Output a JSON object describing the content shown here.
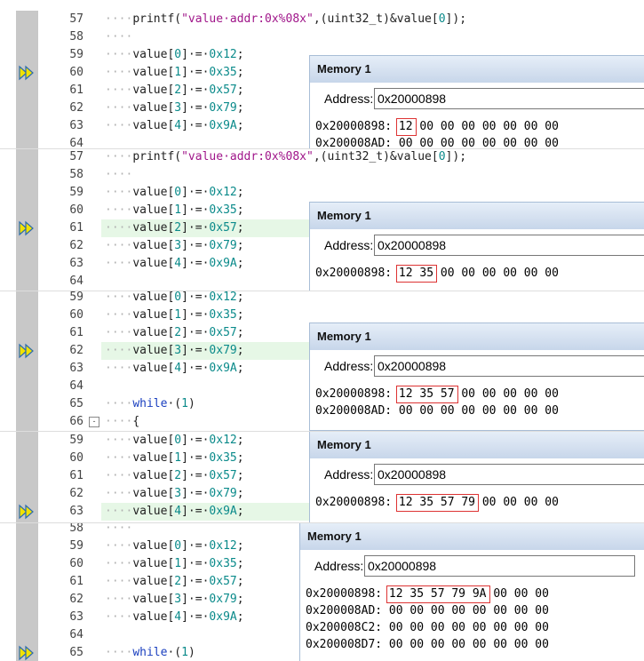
{
  "panels": [
    {
      "lines": [
        {
          "n": "57",
          "code": [
            [
              "dots",
              "····"
            ],
            [
              "t",
              "printf("
            ],
            [
              "str",
              "\"value·addr:0x%08x\""
            ],
            [
              "t",
              ",(uint32_t)&value["
            ],
            [
              "num",
              "0"
            ],
            [
              "t",
              "]);"
            ]
          ]
        },
        {
          "n": "58",
          "code": [
            [
              "dots",
              "····"
            ]
          ]
        },
        {
          "n": "59",
          "code": [
            [
              "dots",
              "····"
            ],
            [
              "t",
              "value["
            ],
            [
              "num",
              "0"
            ],
            [
              "t",
              "]·=·"
            ],
            [
              "num",
              "0x12"
            ],
            [
              "t",
              ";"
            ]
          ]
        },
        {
          "n": "60",
          "code": [
            [
              "dots",
              "····"
            ],
            [
              "t",
              "value["
            ],
            [
              "num",
              "1"
            ],
            [
              "t",
              "]·=·"
            ],
            [
              "num",
              "0x35"
            ],
            [
              "t",
              ";"
            ]
          ]
        },
        {
          "n": "61",
          "code": [
            [
              "dots",
              "····"
            ],
            [
              "t",
              "value["
            ],
            [
              "num",
              "2"
            ],
            [
              "t",
              "]·=·"
            ],
            [
              "num",
              "0x57"
            ],
            [
              "t",
              ";"
            ]
          ]
        },
        {
          "n": "62",
          "code": [
            [
              "dots",
              "····"
            ],
            [
              "t",
              "value["
            ],
            [
              "num",
              "3"
            ],
            [
              "t",
              "]·=·"
            ],
            [
              "num",
              "0x79"
            ],
            [
              "t",
              ";"
            ]
          ]
        },
        {
          "n": "63",
          "code": [
            [
              "dots",
              "····"
            ],
            [
              "t",
              "value["
            ],
            [
              "num",
              "4"
            ],
            [
              "t",
              "]·=·"
            ],
            [
              "num",
              "0x9A"
            ],
            [
              "t",
              ";"
            ]
          ]
        },
        {
          "n": "64",
          "code": []
        }
      ],
      "arrow_line": "60",
      "highlight": "",
      "memory": {
        "title": "Memory 1",
        "address_label": "Address:",
        "address": "0x20000898",
        "rows": [
          "0x20000898: 12 00 00 00 00 00 00 00",
          "0x200008AD: 00 00 00 00 00 00 00 00"
        ],
        "box_bytes": 1
      }
    },
    {
      "lines": [
        {
          "n": "57",
          "code": [
            [
              "dots",
              "····"
            ],
            [
              "t",
              "printf("
            ],
            [
              "str",
              "\"value·addr:0x%08x\""
            ],
            [
              "t",
              ",(uint32_t)&value["
            ],
            [
              "num",
              "0"
            ],
            [
              "t",
              "]);"
            ]
          ]
        },
        {
          "n": "58",
          "code": [
            [
              "dots",
              "····"
            ]
          ]
        },
        {
          "n": "59",
          "code": [
            [
              "dots",
              "····"
            ],
            [
              "t",
              "value["
            ],
            [
              "num",
              "0"
            ],
            [
              "t",
              "]·=·"
            ],
            [
              "num",
              "0x12"
            ],
            [
              "t",
              ";"
            ]
          ]
        },
        {
          "n": "60",
          "code": [
            [
              "dots",
              "····"
            ],
            [
              "t",
              "value["
            ],
            [
              "num",
              "1"
            ],
            [
              "t",
              "]·=·"
            ],
            [
              "num",
              "0x35"
            ],
            [
              "t",
              ";"
            ]
          ]
        },
        {
          "n": "61",
          "code": [
            [
              "dots",
              "····"
            ],
            [
              "t",
              "value["
            ],
            [
              "num",
              "2"
            ],
            [
              "t",
              "]·=·"
            ],
            [
              "num",
              "0x57"
            ],
            [
              "t",
              ";"
            ]
          ]
        },
        {
          "n": "62",
          "code": [
            [
              "dots",
              "····"
            ],
            [
              "t",
              "value["
            ],
            [
              "num",
              "3"
            ],
            [
              "t",
              "]·=·"
            ],
            [
              "num",
              "0x79"
            ],
            [
              "t",
              ";"
            ]
          ]
        },
        {
          "n": "63",
          "code": [
            [
              "dots",
              "····"
            ],
            [
              "t",
              "value["
            ],
            [
              "num",
              "4"
            ],
            [
              "t",
              "]·=·"
            ],
            [
              "num",
              "0x9A"
            ],
            [
              "t",
              ";"
            ]
          ]
        },
        {
          "n": "64",
          "code": []
        }
      ],
      "arrow_line": "61",
      "highlight": "61",
      "memory": {
        "title": "Memory 1",
        "address_label": "Address:",
        "address": "0x20000898",
        "rows": [
          "0x20000898: 12 35 00 00 00 00 00 00"
        ],
        "box_bytes": 2
      }
    },
    {
      "lines": [
        {
          "n": "59",
          "code": [
            [
              "dots",
              "····"
            ],
            [
              "t",
              "value["
            ],
            [
              "num",
              "0"
            ],
            [
              "t",
              "]·=·"
            ],
            [
              "num",
              "0x12"
            ],
            [
              "t",
              ";"
            ]
          ]
        },
        {
          "n": "60",
          "code": [
            [
              "dots",
              "····"
            ],
            [
              "t",
              "value["
            ],
            [
              "num",
              "1"
            ],
            [
              "t",
              "]·=·"
            ],
            [
              "num",
              "0x35"
            ],
            [
              "t",
              ";"
            ]
          ]
        },
        {
          "n": "61",
          "code": [
            [
              "dots",
              "····"
            ],
            [
              "t",
              "value["
            ],
            [
              "num",
              "2"
            ],
            [
              "t",
              "]·=·"
            ],
            [
              "num",
              "0x57"
            ],
            [
              "t",
              ";"
            ]
          ]
        },
        {
          "n": "62",
          "code": [
            [
              "dots",
              "····"
            ],
            [
              "t",
              "value["
            ],
            [
              "num",
              "3"
            ],
            [
              "t",
              "]·=·"
            ],
            [
              "num",
              "0x79"
            ],
            [
              "t",
              ";"
            ]
          ]
        },
        {
          "n": "63",
          "code": [
            [
              "dots",
              "····"
            ],
            [
              "t",
              "value["
            ],
            [
              "num",
              "4"
            ],
            [
              "t",
              "]·=·"
            ],
            [
              "num",
              "0x9A"
            ],
            [
              "t",
              ";"
            ]
          ]
        },
        {
          "n": "64",
          "code": []
        },
        {
          "n": "65",
          "code": [
            [
              "dots",
              "····"
            ],
            [
              "kw",
              "while"
            ],
            [
              "t",
              "·("
            ],
            [
              "num",
              "1"
            ],
            [
              "t",
              ")"
            ]
          ]
        },
        {
          "n": "66",
          "code": [
            [
              "dots",
              "····"
            ],
            [
              "t",
              "{"
            ]
          ],
          "fold": "-"
        }
      ],
      "arrow_line": "62",
      "highlight": "62",
      "memory": {
        "title": "Memory 1",
        "address_label": "Address:",
        "address": "0x20000898",
        "rows": [
          "0x20000898: 12 35 57 00 00 00 00 00",
          "0x200008AD: 00 00 00 00 00 00 00 00"
        ],
        "box_bytes": 3
      }
    },
    {
      "lines": [
        {
          "n": "59",
          "code": [
            [
              "dots",
              "····"
            ],
            [
              "t",
              "value["
            ],
            [
              "num",
              "0"
            ],
            [
              "t",
              "]·=·"
            ],
            [
              "num",
              "0x12"
            ],
            [
              "t",
              ";"
            ]
          ]
        },
        {
          "n": "60",
          "code": [
            [
              "dots",
              "····"
            ],
            [
              "t",
              "value["
            ],
            [
              "num",
              "1"
            ],
            [
              "t",
              "]·=·"
            ],
            [
              "num",
              "0x35"
            ],
            [
              "t",
              ";"
            ]
          ]
        },
        {
          "n": "61",
          "code": [
            [
              "dots",
              "····"
            ],
            [
              "t",
              "value["
            ],
            [
              "num",
              "2"
            ],
            [
              "t",
              "]·=·"
            ],
            [
              "num",
              "0x57"
            ],
            [
              "t",
              ";"
            ]
          ]
        },
        {
          "n": "62",
          "code": [
            [
              "dots",
              "····"
            ],
            [
              "t",
              "value["
            ],
            [
              "num",
              "3"
            ],
            [
              "t",
              "]·=·"
            ],
            [
              "num",
              "0x79"
            ],
            [
              "t",
              ";"
            ]
          ]
        },
        {
          "n": "63",
          "code": [
            [
              "dots",
              "····"
            ],
            [
              "t",
              "value["
            ],
            [
              "num",
              "4"
            ],
            [
              "t",
              "]·=·"
            ],
            [
              "num",
              "0x9A"
            ],
            [
              "t",
              ";"
            ]
          ]
        }
      ],
      "arrow_line": "63",
      "highlight": "63",
      "memory": {
        "title": "Memory 1",
        "address_label": "Address:",
        "address": "0x20000898",
        "rows": [
          "0x20000898: 12 35 57 79 00 00 00 00"
        ],
        "box_bytes": 4
      }
    },
    {
      "lines": [
        {
          "n": "58",
          "code": [
            [
              "dots",
              "····"
            ]
          ]
        },
        {
          "n": "59",
          "code": [
            [
              "dots",
              "····"
            ],
            [
              "t",
              "value["
            ],
            [
              "num",
              "0"
            ],
            [
              "t",
              "]·=·"
            ],
            [
              "num",
              "0x12"
            ],
            [
              "t",
              ";"
            ]
          ]
        },
        {
          "n": "60",
          "code": [
            [
              "dots",
              "····"
            ],
            [
              "t",
              "value["
            ],
            [
              "num",
              "1"
            ],
            [
              "t",
              "]·=·"
            ],
            [
              "num",
              "0x35"
            ],
            [
              "t",
              ";"
            ]
          ]
        },
        {
          "n": "61",
          "code": [
            [
              "dots",
              "····"
            ],
            [
              "t",
              "value["
            ],
            [
              "num",
              "2"
            ],
            [
              "t",
              "]·=·"
            ],
            [
              "num",
              "0x57"
            ],
            [
              "t",
              ";"
            ]
          ]
        },
        {
          "n": "62",
          "code": [
            [
              "dots",
              "····"
            ],
            [
              "t",
              "value["
            ],
            [
              "num",
              "3"
            ],
            [
              "t",
              "]·=·"
            ],
            [
              "num",
              "0x79"
            ],
            [
              "t",
              ";"
            ]
          ]
        },
        {
          "n": "63",
          "code": [
            [
              "dots",
              "····"
            ],
            [
              "t",
              "value["
            ],
            [
              "num",
              "4"
            ],
            [
              "t",
              "]·=·"
            ],
            [
              "num",
              "0x9A"
            ],
            [
              "t",
              ";"
            ]
          ]
        },
        {
          "n": "64",
          "code": []
        },
        {
          "n": "65",
          "code": [
            [
              "dots",
              "····"
            ],
            [
              "kw",
              "while"
            ],
            [
              "t",
              "·("
            ],
            [
              "num",
              "1"
            ],
            [
              "t",
              ")"
            ]
          ]
        }
      ],
      "arrow_line": "65",
      "highlight": "",
      "memory": {
        "title": "Memory 1",
        "address_label": "Address:",
        "address": "0x20000898",
        "rows": [
          "0x20000898: 12 35 57 79 9A 00 00 00",
          "0x200008AD: 00 00 00 00 00 00 00 00",
          "0x200008C2: 00 00 00 00 00 00 00 00",
          "0x200008D7: 00 00 00 00 00 00 00 00"
        ],
        "box_bytes": 5
      }
    }
  ],
  "icons": {
    "arrow": "current-line-arrow-icon",
    "fold": "fold-collapse-icon"
  },
  "colors": {
    "gutter": "#c8c8c8",
    "highlight": "#e6f7e6",
    "memtitle": "#c7d6ea",
    "redbox": "#d33"
  }
}
